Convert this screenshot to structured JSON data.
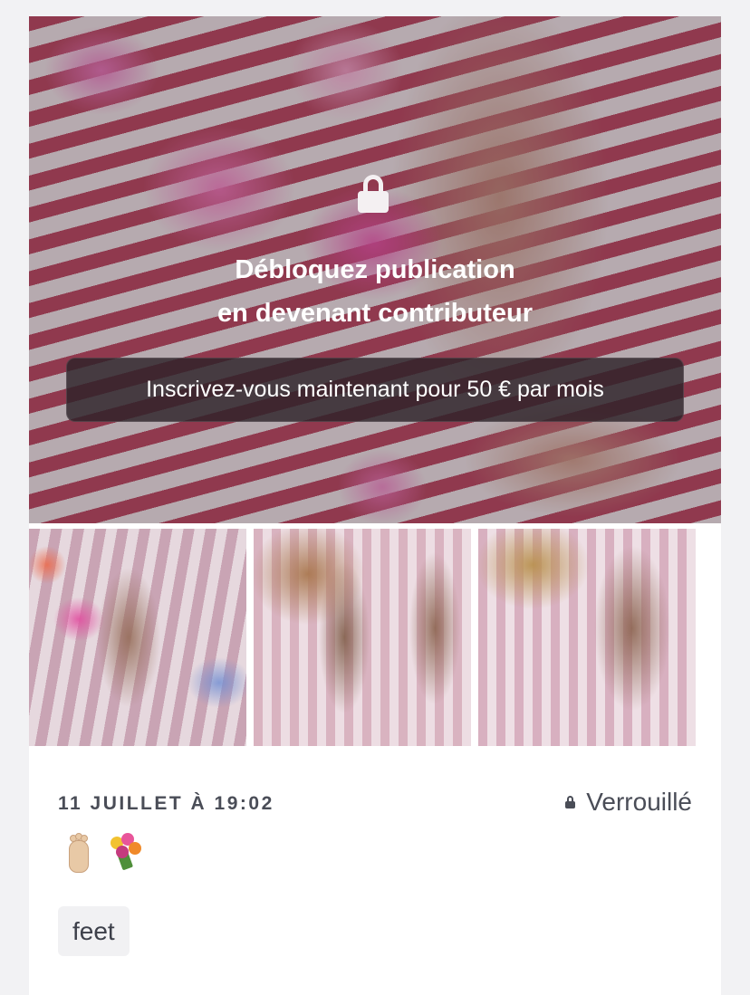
{
  "post": {
    "unlock_title_line1": "Débloquez publication",
    "unlock_title_line2": "en devenant contributeur",
    "subscribe_button": "Inscrivez-vous maintenant pour 50 € par mois",
    "date": "11 JUILLET À 19:02",
    "status": "Verrouillé",
    "emojis": [
      "foot-emoji",
      "bouquet-emoji"
    ],
    "tags": [
      "feet"
    ]
  },
  "icons": {
    "hero_lock": "lock-icon",
    "status_lock": "lock-icon"
  },
  "colors": {
    "overlay_button_bg": "#2d2228",
    "meta_text": "#4a4d57",
    "tag_bg": "#f1f1f3"
  }
}
